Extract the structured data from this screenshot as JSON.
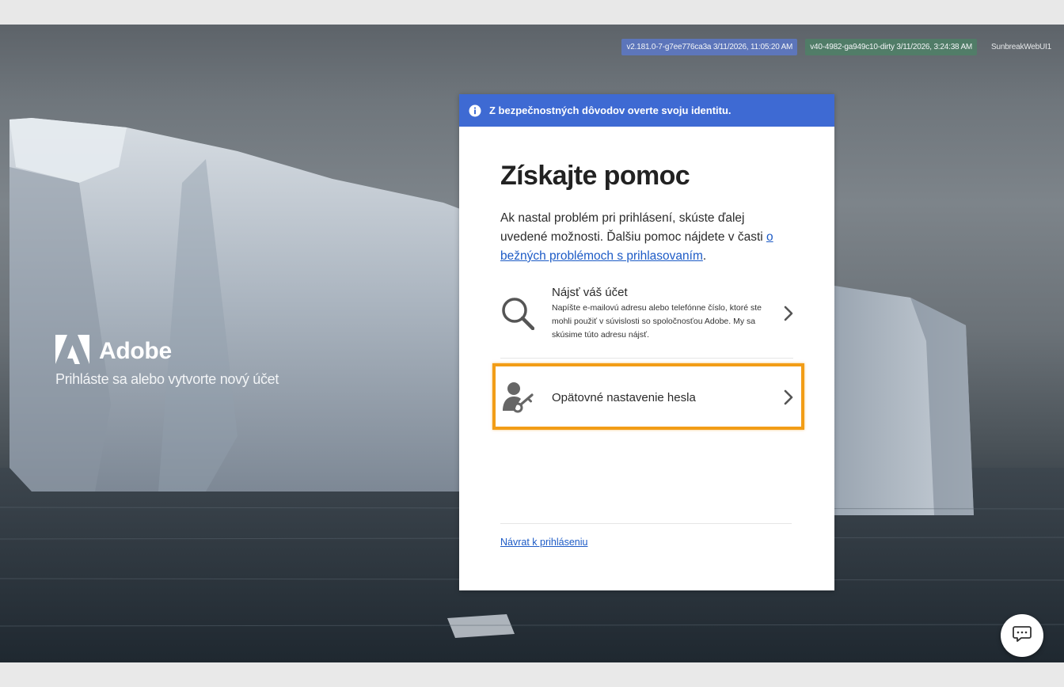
{
  "versions": {
    "build_blue": "v2.181.0-7-g7ee776ca3a 3/11/2026, 11:05:20 AM",
    "build_green": "v40-4982-ga949c10-dirty 3/11/2026, 3:24:38 AM",
    "app_name": "SunbreakWebUI1"
  },
  "brand": {
    "name": "Adobe",
    "tagline": "Prihláste sa alebo vytvorte nový účet"
  },
  "dialog": {
    "banner": "Z bezpečnostných dôvodov overte svoju identitu.",
    "title": "Získajte pomoc",
    "intro_text": "Ak nastal problém pri prihlásení, skúste ďalej uvedené možnosti. Ďalšiu pomoc nájdete v časti ",
    "intro_link": "o bežných problémoch s prihlasovaním",
    "intro_end": ".",
    "options": [
      {
        "title": "Nájsť váš účet",
        "description": "Napíšte e-mailovú adresu alebo telefónne číslo, ktoré ste mohli použiť v súvislosti so spoločnosťou Adobe. My sa skúsime túto adresu nájsť.",
        "icon": "search-icon"
      },
      {
        "title": "Opätovné nastavenie hesla",
        "icon": "user-key-icon"
      }
    ],
    "back_link": "Návrat k prihláseniu"
  },
  "colors": {
    "banner": "#3e6ad3",
    "link": "#1d5bc6",
    "highlight": "#f29d16"
  }
}
